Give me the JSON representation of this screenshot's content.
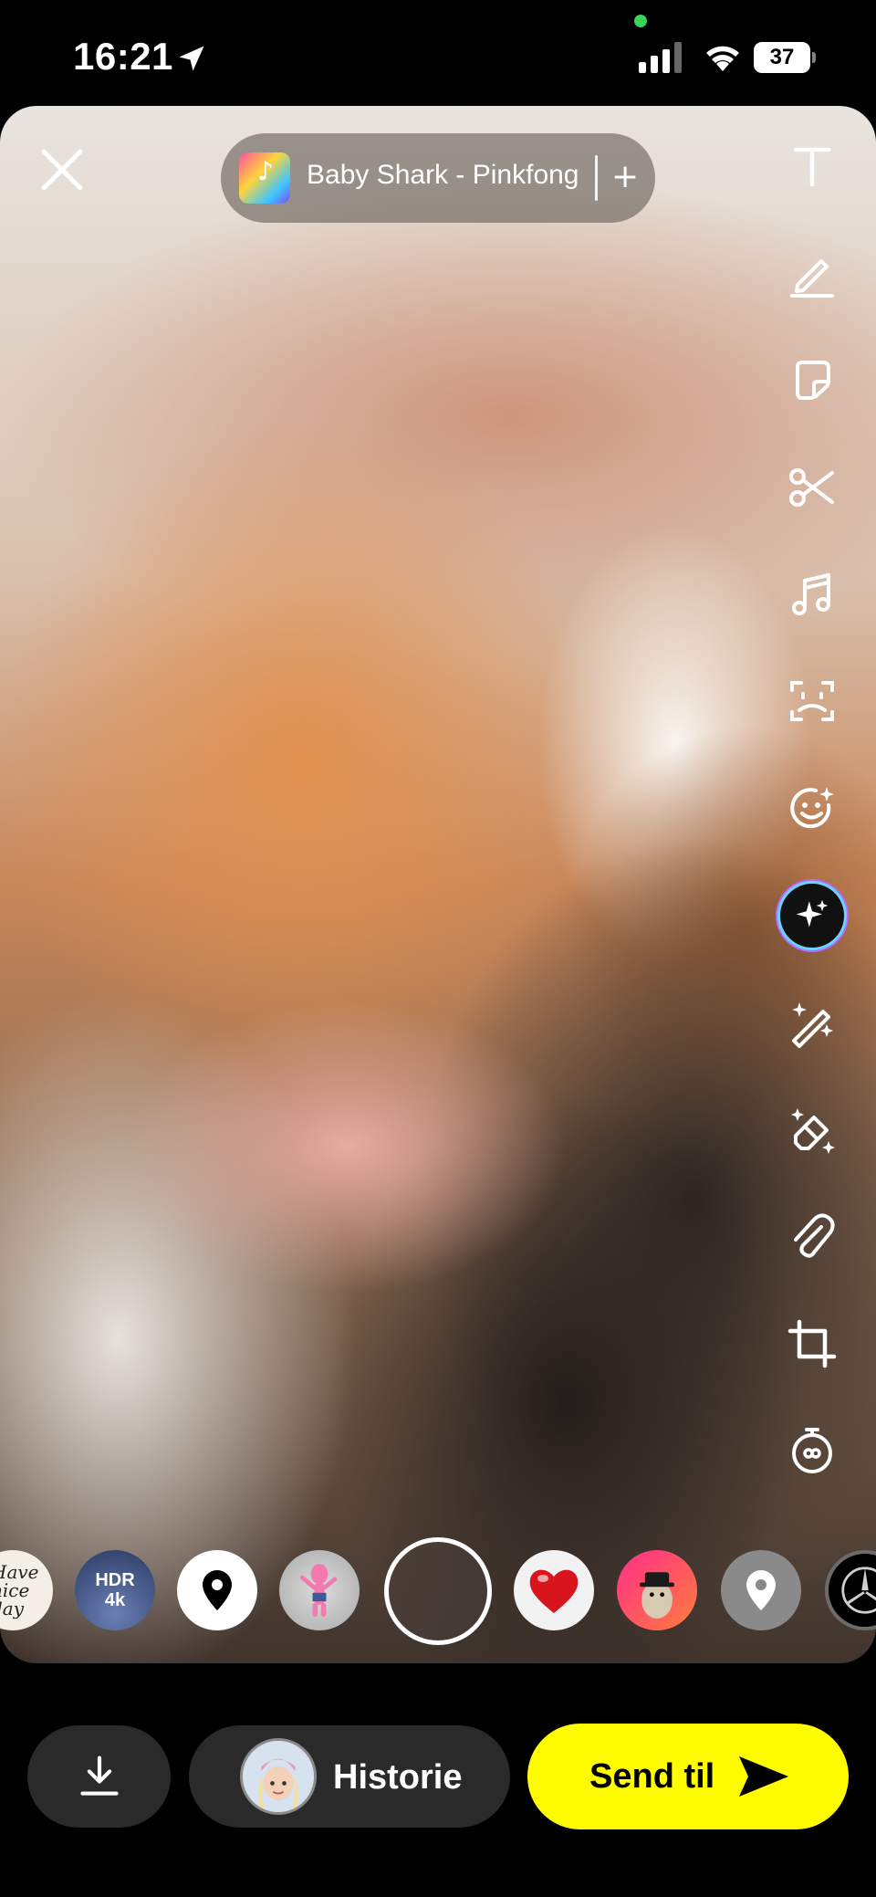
{
  "status_bar": {
    "time": "16:21",
    "battery": "37"
  },
  "music": {
    "title": "Baby Shark - Pinkfong",
    "add_label": "+"
  },
  "toolbar": {
    "tools": [
      "text-icon",
      "pen-icon",
      "sticker-icon",
      "scissors-icon",
      "music-icon",
      "scan-icon",
      "emoji-icon",
      "ai-sparkle-icon",
      "magic-wand-icon",
      "eraser-icon",
      "paperclip-icon",
      "crop-icon",
      "timer-icon"
    ]
  },
  "lenses": {
    "have_nice_day": "Have nice day",
    "hdr_line1": "HDR",
    "hdr_line2": "4k"
  },
  "bottom": {
    "story_label": "Historie",
    "send_label": "Send til"
  },
  "colors": {
    "send_button": "#fffc00",
    "pill": "#2a2a2a"
  }
}
